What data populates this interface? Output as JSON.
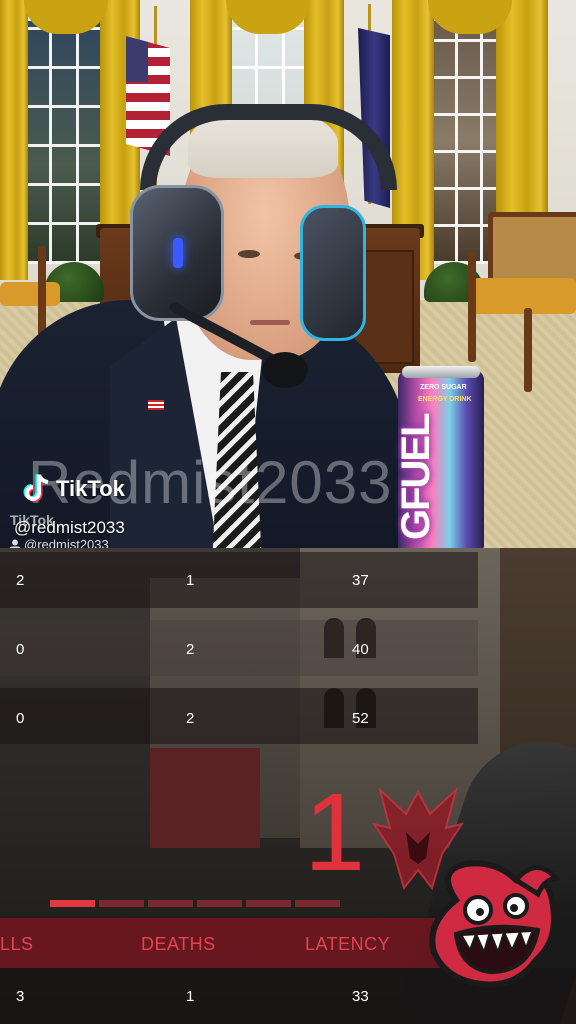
{
  "top_video": {
    "watermark_text": "Redmist2033",
    "tiktok_label": "TikTok",
    "handle_primary": "@redmist2033",
    "mini_tiktok_label": "TikTok",
    "handle_secondary": "@redmist2033",
    "can": {
      "line1": "ZERO SUGAR",
      "line2": "ENERGY DRINK",
      "brand": "GFUEL"
    }
  },
  "scoreboard": {
    "rows": [
      {
        "kills": "2",
        "deaths": "1",
        "latency": "37"
      },
      {
        "kills": "0",
        "deaths": "2",
        "latency": "40"
      },
      {
        "kills": "0",
        "deaths": "2",
        "latency": "52"
      }
    ],
    "big_number": "1",
    "headers": {
      "kills": "LLS",
      "deaths": "DEATHS",
      "latency": "LATENCY"
    },
    "current_row": {
      "kills": "3",
      "deaths": "1",
      "latency": "33"
    },
    "progress_segments": 6,
    "progress_filled": 1,
    "accent_color": "#e23842"
  },
  "icons": [
    "tiktok-icon",
    "team-emblem-icon",
    "mascot-icon",
    "user-icon"
  ]
}
